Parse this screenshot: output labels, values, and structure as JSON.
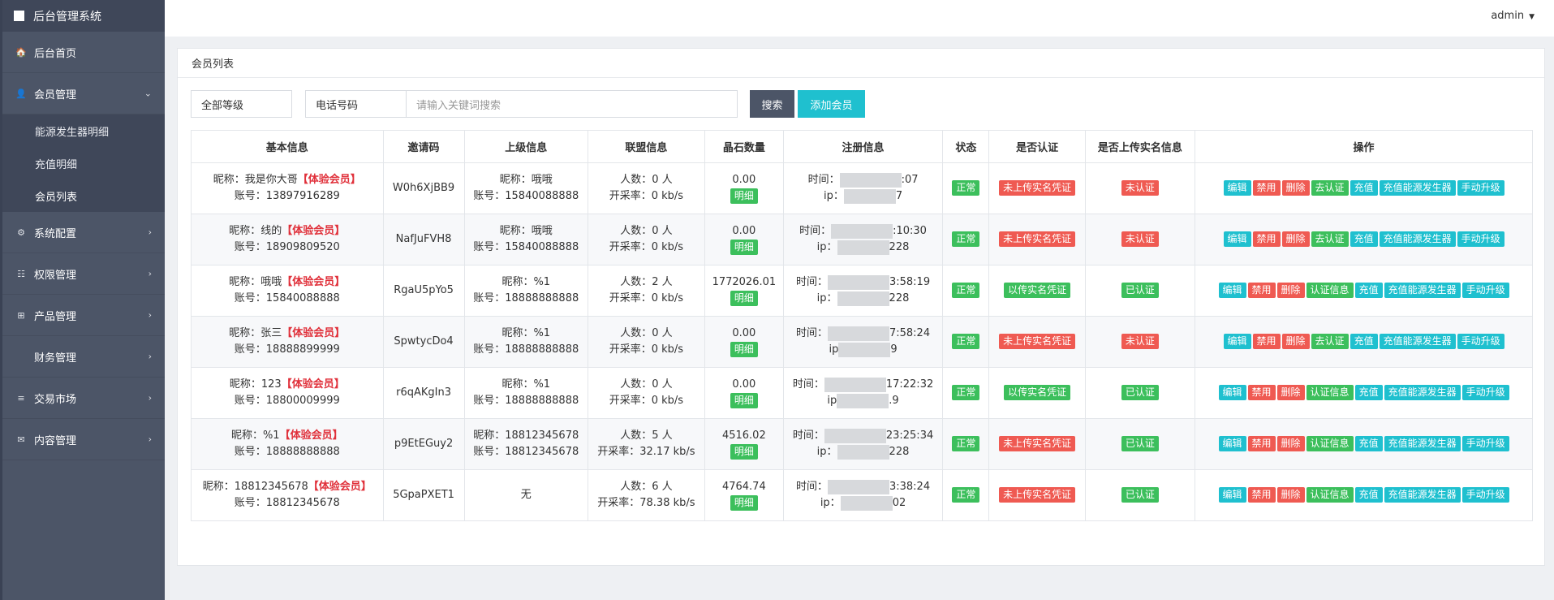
{
  "brand": "后台管理系统",
  "nav": [
    {
      "label": "后台首页",
      "icon": "home-icon",
      "glyph": "🏠"
    },
    {
      "label": "会员管理",
      "icon": "user-icon",
      "glyph": "👤",
      "chev": "⌄"
    },
    {
      "label": "系统配置",
      "icon": "cogs-icon",
      "glyph": "⚙",
      "chev": "›"
    },
    {
      "label": "权限管理",
      "icon": "list-icon",
      "glyph": "☷",
      "chev": "›"
    },
    {
      "label": "产品管理",
      "icon": "windows-icon",
      "glyph": "⊞",
      "chev": "›"
    },
    {
      "label": "财务管理",
      "icon": "",
      "glyph": "",
      "chev": "›"
    },
    {
      "label": "交易市场",
      "icon": "bars-icon",
      "glyph": "≡",
      "chev": "›"
    },
    {
      "label": "内容管理",
      "icon": "envelope-icon",
      "glyph": "✉",
      "chev": "›"
    }
  ],
  "sub_nav": [
    "能源发生器明细",
    "充值明细",
    "会员列表"
  ],
  "user": "admin",
  "panel_title": "会员列表",
  "filters": {
    "level": "全部等级",
    "phone": "电话号码",
    "keyword_placeholder": "请输入关键词搜索"
  },
  "buttons": {
    "search": "搜索",
    "add": "添加会员",
    "detail": "明细"
  },
  "headers": [
    "基本信息",
    "邀请码",
    "上级信息",
    "联盟信息",
    "晶石数量",
    "注册信息",
    "状态",
    "是否认证",
    "是否上传实名信息",
    "操作"
  ],
  "colors": {
    "green": "#3cbf5c",
    "red": "#ef5a52",
    "cyan": "#1fc0cf",
    "sidebar": "#4c5567"
  },
  "rows": [
    {
      "nick": "昵称：我是你大哥",
      "vip": "【体验会员】",
      "account": "账号：13897916289",
      "code": "W0h6XjBB9",
      "parent1": "昵称：哦哦",
      "parent2": "账号：15840088888",
      "people": "人数：0 人",
      "rate": "开采率：0 kb/s",
      "crystal": "0.00",
      "time_pre": "时间：",
      "time_post": ":07",
      "ip_pre": "ip：",
      "ip_post": "7",
      "status": "正常",
      "cert": "未上传实名凭证",
      "cert_ok": false,
      "real": "未认证",
      "real_ok": false,
      "ops": [
        "编辑",
        "禁用",
        "删除",
        "去认证",
        "充值",
        "充值能源发生器",
        "手动升级"
      ]
    },
    {
      "nick": "昵称：线的",
      "vip": "【体验会员】",
      "account": "账号：18909809520",
      "code": "NafJuFVH8",
      "parent1": "昵称：哦哦",
      "parent2": "账号：15840088888",
      "people": "人数：0 人",
      "rate": "开采率：0 kb/s",
      "crystal": "0.00",
      "time_pre": "时间：",
      "time_post": ":10:30",
      "ip_pre": "ip：",
      "ip_post": "228",
      "status": "正常",
      "cert": "未上传实名凭证",
      "cert_ok": false,
      "real": "未认证",
      "real_ok": false,
      "ops": [
        "编辑",
        "禁用",
        "删除",
        "去认证",
        "充值",
        "充值能源发生器",
        "手动升级"
      ]
    },
    {
      "nick": "昵称：哦哦",
      "vip": "【体验会员】",
      "account": "账号：15840088888",
      "code": "RgaU5pYo5",
      "parent1": "昵称：%1",
      "parent2": "账号：18888888888",
      "people": "人数：2 人",
      "rate": "开采率：0 kb/s",
      "crystal": "1772026.01",
      "time_pre": "时间：",
      "time_post": "3:58:19",
      "ip_pre": "ip：",
      "ip_post": "228",
      "status": "正常",
      "cert": "以传实名凭证",
      "cert_ok": true,
      "real": "已认证",
      "real_ok": true,
      "ops": [
        "编辑",
        "禁用",
        "删除",
        "认证信息",
        "充值",
        "充值能源发生器",
        "手动升级"
      ]
    },
    {
      "nick": "昵称：张三",
      "vip": "【体验会员】",
      "account": "账号：18888899999",
      "code": "SpwtycDo4",
      "parent1": "昵称：%1",
      "parent2": "账号：18888888888",
      "people": "人数：0 人",
      "rate": "开采率：0 kb/s",
      "crystal": "0.00",
      "time_pre": "时间：",
      "time_post": "7:58:24",
      "ip_pre": "ip",
      "ip_post": "9",
      "status": "正常",
      "cert": "未上传实名凭证",
      "cert_ok": false,
      "real": "未认证",
      "real_ok": false,
      "ops": [
        "编辑",
        "禁用",
        "删除",
        "去认证",
        "充值",
        "充值能源发生器",
        "手动升级"
      ]
    },
    {
      "nick": "昵称：123",
      "vip": "【体验会员】",
      "account": "账号：18800009999",
      "code": "r6qAKgIn3",
      "parent1": "昵称：%1",
      "parent2": "账号：18888888888",
      "people": "人数：0 人",
      "rate": "开采率：0 kb/s",
      "crystal": "0.00",
      "time_pre": "时间：",
      "time_post": "17:22:32",
      "ip_pre": "ip",
      "ip_post": ".9",
      "status": "正常",
      "cert": "以传实名凭证",
      "cert_ok": true,
      "real": "已认证",
      "real_ok": true,
      "ops": [
        "编辑",
        "禁用",
        "删除",
        "认证信息",
        "充值",
        "充值能源发生器",
        "手动升级"
      ]
    },
    {
      "nick": "昵称：%1",
      "vip": "【体验会员】",
      "account": "账号：18888888888",
      "code": "p9EtEGuy2",
      "parent1": "昵称：18812345678",
      "parent2": "账号：18812345678",
      "people": "人数：5 人",
      "rate": "开采率：32.17 kb/s",
      "crystal": "4516.02",
      "time_pre": "时间：",
      "time_post": "23:25:34",
      "ip_pre": "ip：",
      "ip_post": "228",
      "status": "正常",
      "cert": "未上传实名凭证",
      "cert_ok": false,
      "real": "已认证",
      "real_ok": true,
      "ops": [
        "编辑",
        "禁用",
        "删除",
        "认证信息",
        "充值",
        "充值能源发生器",
        "手动升级"
      ]
    },
    {
      "nick": "昵称：18812345678",
      "vip": "【体验会员】",
      "account": "账号：18812345678",
      "code": "5GpaPXET1",
      "parent1": "无",
      "parent2": "",
      "people": "人数：6 人",
      "rate": "开采率：78.38 kb/s",
      "crystal": "4764.74",
      "time_pre": "时间：",
      "time_post": "3:38:24",
      "ip_pre": "ip：",
      "ip_post": "02",
      "status": "正常",
      "cert": "未上传实名凭证",
      "cert_ok": false,
      "real": "已认证",
      "real_ok": true,
      "ops": [
        "编辑",
        "禁用",
        "删除",
        "认证信息",
        "充值",
        "充值能源发生器",
        "手动升级"
      ]
    }
  ]
}
